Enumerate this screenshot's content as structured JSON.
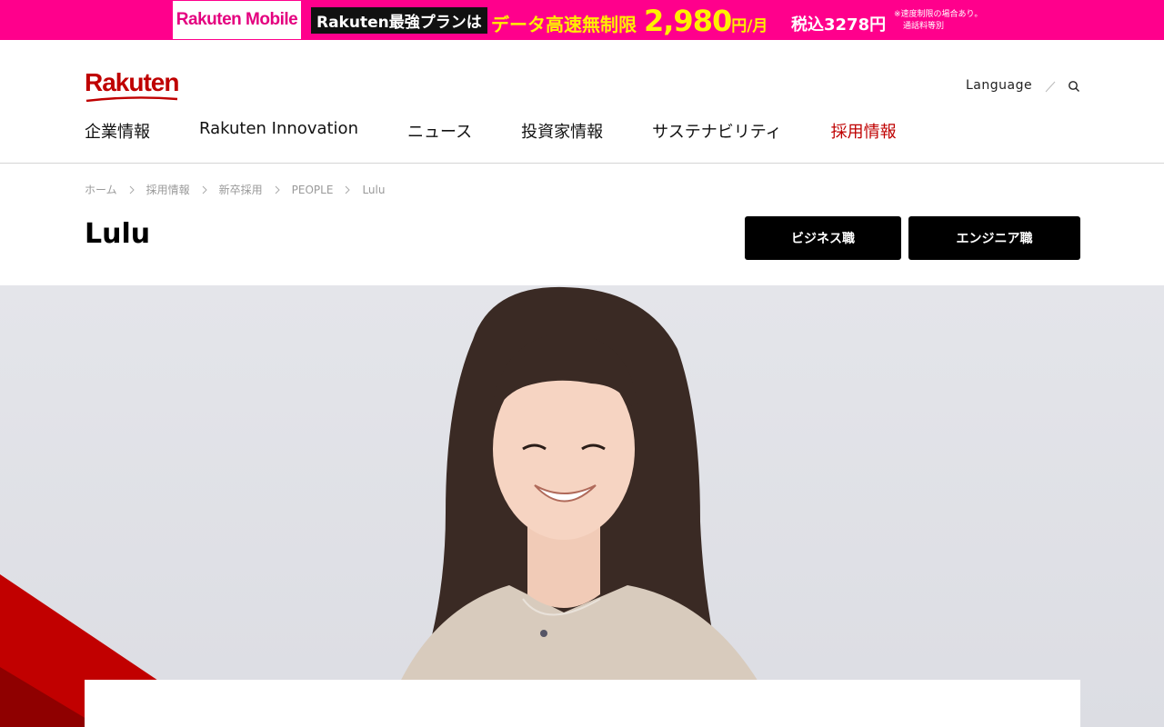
{
  "promo": {
    "logo": "Rakuten Mobile",
    "plan": "Rakuten最強プランは",
    "headline": "データ高速無制限",
    "price": "2,980",
    "price_unit": "円/月",
    "tax": "税込3278円",
    "note_line1": "※速度制限の場合あり。",
    "note_line2": "通話料等別"
  },
  "header": {
    "logo": "Rakuten",
    "language": "Language",
    "nav": [
      "企業情報",
      "Rakuten Innovation",
      "ニュース",
      "投資家情報",
      "サステナビリティ",
      "採用情報"
    ]
  },
  "breadcrumb": [
    "ホーム",
    "採用情報",
    "新卒採用",
    "PEOPLE",
    "Lulu"
  ],
  "page": {
    "title": "Lulu",
    "button_business": "ビジネス職",
    "button_engineer": "エンジニア職"
  },
  "colors": {
    "brand": "#bf0000",
    "promo": "#ff008c",
    "promo_accent": "#ffef00"
  }
}
